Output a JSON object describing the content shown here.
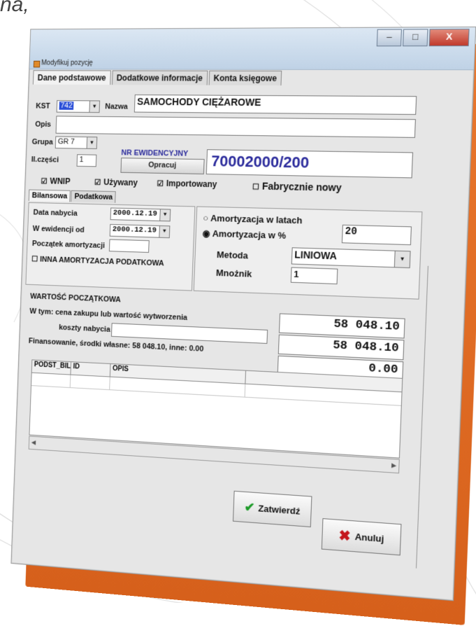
{
  "top_text": "na,",
  "window": {
    "title": "Modyfikuj pozycję",
    "buttons": {
      "minimize": "–",
      "maximize": "□",
      "close": "X"
    }
  },
  "main_tabs": [
    "Dane podstawowe",
    "Dodatkowe informacje",
    "Konta księgowe"
  ],
  "fields": {
    "kst_label": "KST",
    "kst_value": "742",
    "nazwa_label": "Nazwa",
    "nazwa_value": "SAMOCHODY CIĘŻAROWE",
    "opis_label": "Opis",
    "opis_value": "",
    "grupa_label": "Grupa",
    "grupa_value": "GR 7",
    "czesci_label": "Il.części",
    "czesci_value": "1",
    "ewid_label": "NR EWIDENCYJNY",
    "ewid_button": "Opracuj",
    "ewid_value": "70002000/200"
  },
  "checkboxes": {
    "wnip": "WNIP",
    "uzywany": "Używany",
    "importowany": "Importowany",
    "fabrycznie": "Fabrycznie nowy",
    "checked_mark": "☑",
    "unchecked_mark": "☐"
  },
  "sub_tabs": [
    "Bilansowa",
    "Podatkowa"
  ],
  "dates": {
    "data_nabycia_label": "Data nabycia",
    "data_nabycia": "2000.12.19",
    "w_ewidencji_label": "W ewidencji od",
    "w_ewidencji": "2000.12.19",
    "poczatek_label": "Początek amortyzacji",
    "poczatek": "",
    "inna_label": "INNA AMORTYZACJA PODATKOWA"
  },
  "amortization": {
    "latach_label": "Amortyzacja w latach",
    "procent_label": "Amortyzacja w %",
    "procent_value": "20",
    "metoda_label": "Metoda",
    "metoda_value": "LINIOWA",
    "mnoznik_label": "Mnożnik",
    "mnoznik_value": "1"
  },
  "value": {
    "wartosc_label": "WARTOŚĆ POCZĄTKOWA",
    "wartosc": "58 048.10",
    "cena_label": "W tym: cena zakupu lub wartość wytworzenia",
    "cena": "58 048.10",
    "koszty_label": "koszty nabycia",
    "koszty": "0.00",
    "finansowanie": "Finansowanie, środki własne: 58 048.10, inne: 0.00"
  },
  "grid": {
    "columns": [
      "PODST_BIL",
      "ID",
      "OPIS"
    ]
  },
  "actions": {
    "confirm": "Zatwierdź",
    "cancel": "Anuluj"
  },
  "colors": {
    "accent_blue": "#2b2b9c",
    "slab_orange": "#e9772d"
  }
}
